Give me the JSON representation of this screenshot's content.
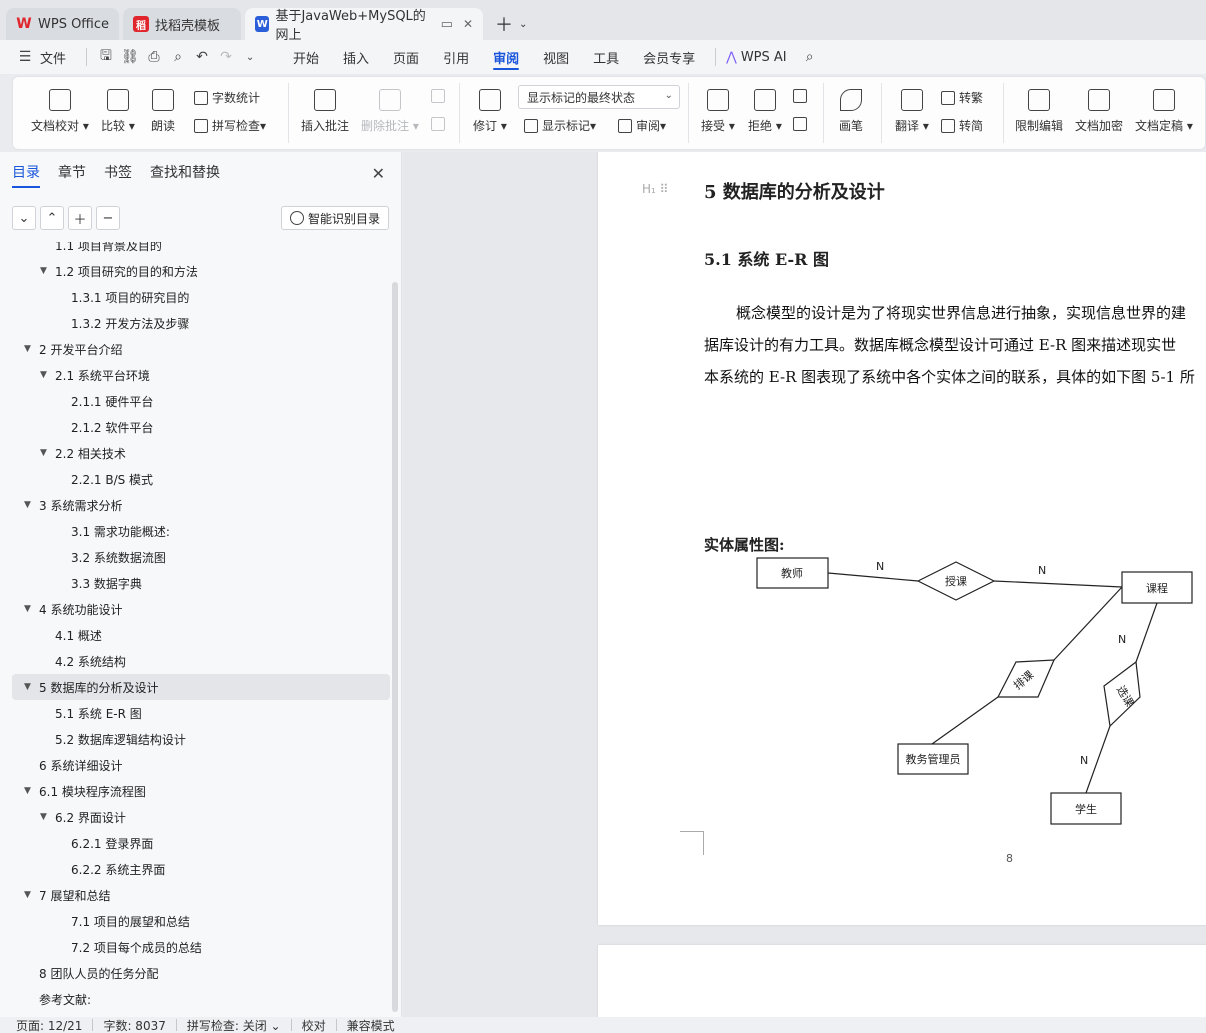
{
  "tabs": [
    {
      "label": "WPS Office",
      "active": false
    },
    {
      "label": "找稻壳模板",
      "active": false
    },
    {
      "label": "基于JavaWeb+MySQL的网上",
      "active": true
    }
  ],
  "menu": {
    "file": "文件",
    "items": [
      "开始",
      "插入",
      "页面",
      "引用",
      "审阅",
      "视图",
      "工具",
      "会员专享"
    ],
    "active": "审阅",
    "ai": "WPS AI"
  },
  "ribbon": {
    "doc_check": "文档校对",
    "compare": "比较",
    "read": "朗读",
    "word_count": "字数统计",
    "spell_check": "拼写检查",
    "insert_comment": "插入批注",
    "delete_comment": "删除批注",
    "revise": "修订",
    "display_state": "显示标记的最终状态",
    "show_marks": "显示标记",
    "review": "审阅",
    "accept": "接受",
    "reject": "拒绝",
    "pen": "画笔",
    "translate": "翻译",
    "to_traditional": "转繁",
    "to_simplified": "转简",
    "restrict_edit": "限制编辑",
    "encrypt": "文档加密",
    "finalize": "文档定稿"
  },
  "nav": {
    "tabs": [
      "目录",
      "章节",
      "书签",
      "查找和替换"
    ],
    "smart_toc": "智能识别目录",
    "toc": [
      {
        "label": "1.1  项目背景及目的",
        "level": 2,
        "caret": false
      },
      {
        "label": "1.2  项目研究的目的和方法",
        "level": 2,
        "caret": true
      },
      {
        "label": "1.3.1  项目的研究目的",
        "level": 3,
        "caret": false
      },
      {
        "label": "1.3.2  开发方法及步骤",
        "level": 3,
        "caret": false
      },
      {
        "label": "2  开发平台介绍",
        "level": 1,
        "caret": true
      },
      {
        "label": "2.1  系统平台环境",
        "level": 2,
        "caret": true
      },
      {
        "label": "2.1.1  硬件平台",
        "level": 3,
        "caret": false
      },
      {
        "label": "2.1.2  软件平台",
        "level": 3,
        "caret": false
      },
      {
        "label": "2.2 相关技术",
        "level": 2,
        "caret": true
      },
      {
        "label": "2.2.1 B/S 模式",
        "level": 3,
        "caret": false
      },
      {
        "label": "3  系统需求分析",
        "level": 1,
        "caret": true
      },
      {
        "label": "3.1 需求功能概述:",
        "level": 3,
        "caret": false
      },
      {
        "label": "3.2  系统数据流图",
        "level": 3,
        "caret": false
      },
      {
        "label": "3.3  数据字典",
        "level": 3,
        "caret": false
      },
      {
        "label": "4 系统功能设计",
        "level": 1,
        "caret": true
      },
      {
        "label": "4.1  概述",
        "level": 2,
        "caret": false
      },
      {
        "label": "4.2  系统结构",
        "level": 2,
        "caret": false
      },
      {
        "label": "5  数据库的分析及设计",
        "level": 1,
        "caret": true,
        "selected": true
      },
      {
        "label": "5.1  系统 E-R 图",
        "level": 2,
        "caret": false
      },
      {
        "label": "5.2  数据库逻辑结构设计",
        "level": 2,
        "caret": false
      },
      {
        "label": "6  系统详细设计",
        "level": 1,
        "caret": false
      },
      {
        "label": "6.1  模块程序流程图",
        "level": 1,
        "caret": true
      },
      {
        "label": "6.2  界面设计",
        "level": 2,
        "caret": true
      },
      {
        "label": "6.2.1  登录界面",
        "level": 3,
        "caret": false
      },
      {
        "label": "6.2.2 系统主界面",
        "level": 3,
        "caret": false
      },
      {
        "label": "7  展望和总结",
        "level": 1,
        "caret": true
      },
      {
        "label": "7.1  项目的展望和总结",
        "level": 3,
        "caret": false
      },
      {
        "label": "7.2  项目每个成员的总结",
        "level": 3,
        "caret": false
      },
      {
        "label": "8 团队人员的任务分配",
        "level": 1,
        "caret": false
      },
      {
        "label": "参考文献:",
        "level": 1,
        "caret": false
      }
    ]
  },
  "doc": {
    "h1": "5  数据库的分析及设计",
    "h2": "5.1  系统 E-R 图",
    "paras": [
      "概念模型的设计是为了将现实世界信息进行抽象，实现信息世界的建",
      "据库设计的有力工具。数据库概念模型设计可通过 E-R 图来描述现实世",
      "本系统的 E-R 图表现了系统中各个实体之间的联系，具体的如下图 5-1 所"
    ],
    "entity_title": "实体属性图:",
    "er": {
      "entities": {
        "teacher": "教师",
        "course": "课程",
        "admin": "教务管理员",
        "student": "学生"
      },
      "relations": {
        "teach": "授课",
        "schedule": "排课",
        "select": "选课"
      },
      "cardinality": "N"
    },
    "page_number": "8"
  },
  "status": {
    "page": "页面: 12/21",
    "words": "字数: 8037",
    "spell": "拼写检查: 关闭",
    "proof": "校对",
    "compat": "兼容模式"
  }
}
